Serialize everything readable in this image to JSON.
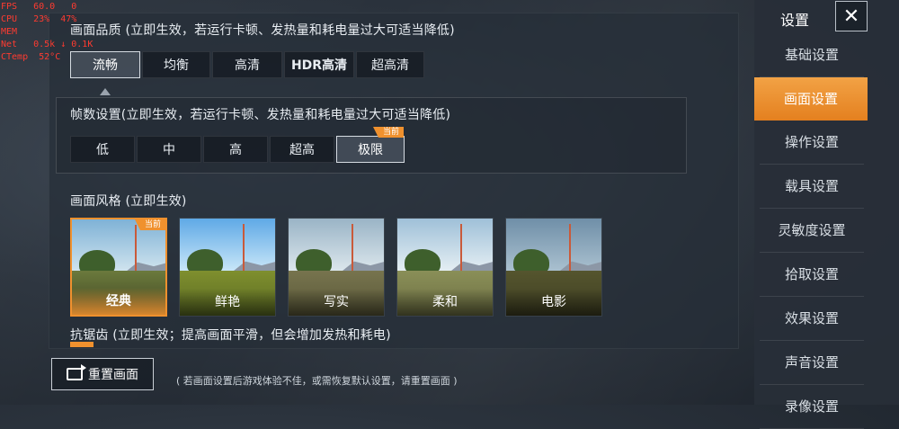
{
  "debug": {
    "lines": [
      "FPS   60.0   0",
      "CPU   23%  47%",
      "MEM",
      "Net   0.5k ↓ 0.1K",
      "CTemp  52°C"
    ]
  },
  "quality": {
    "title": "画面品质 (立即生效，若运行卡顿、发热量和耗电量过大可适当降低)",
    "options": [
      "流畅",
      "均衡",
      "高清",
      "HDR高清",
      "超高清"
    ],
    "selected": "流畅"
  },
  "fps": {
    "title": "帧数设置(立即生效，若运行卡顿、发热量和耗电量过大可适当降低)",
    "options": [
      "低",
      "中",
      "高",
      "超高",
      "极限"
    ],
    "selected": "极限",
    "current_badge": "当前"
  },
  "style": {
    "title": "画面风格 (立即生效)",
    "options": [
      "经典",
      "鲜艳",
      "写实",
      "柔和",
      "电影"
    ],
    "selected": "经典",
    "current_badge": "当前"
  },
  "antialias": {
    "title": "抗锯齿 (立即生效；提高画面平滑，但会增加发热和耗电)"
  },
  "reset": {
    "label": "重置画面",
    "hint": "( 若画面设置后游戏体验不佳，或需恢复默认设置，请重置画面 )"
  },
  "sidebar": {
    "title": "设置",
    "items": [
      "基础设置",
      "画面设置",
      "操作设置",
      "载具设置",
      "灵敏度设置",
      "拾取设置",
      "效果设置",
      "声音设置",
      "录像设置"
    ],
    "active": "画面设置"
  },
  "colors": {
    "accent": "#f0912e",
    "panel_bg": "#262e38"
  }
}
